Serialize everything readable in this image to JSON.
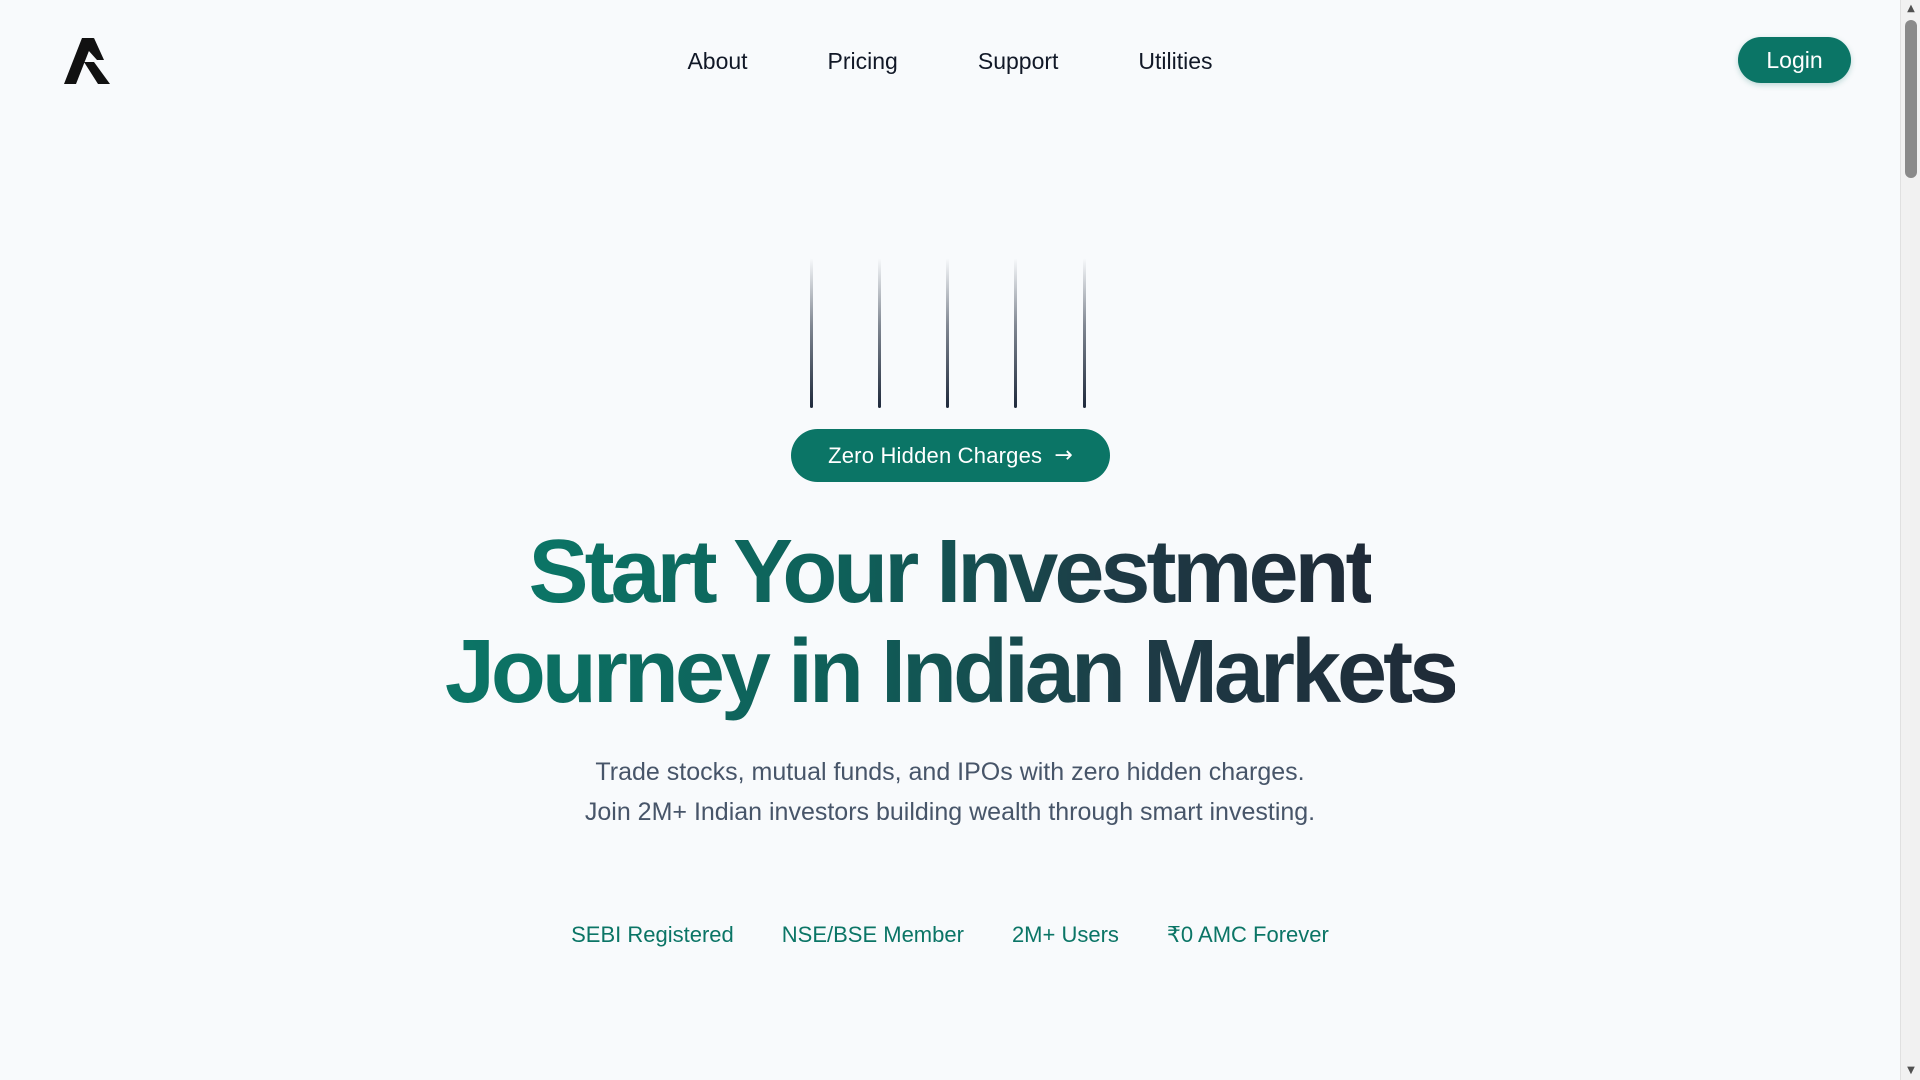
{
  "brand": {
    "logo_icon": "stylized-a-logo-icon"
  },
  "nav": {
    "items": [
      {
        "label": "About"
      },
      {
        "label": "Pricing"
      },
      {
        "label": "Support"
      },
      {
        "label": "Utilities"
      }
    ],
    "login_label": "Login"
  },
  "hero": {
    "pill_label": "Zero Hidden Charges",
    "pill_arrow": "→",
    "title_line1": "Start Your Investment",
    "title_line2": "Journey in Indian Markets",
    "subtitle": "Trade stocks, mutual funds, and IPOs with zero hidden charges. Join 2M+ Indian investors building wealth through smart investing."
  },
  "badges": [
    {
      "label": "SEBI Registered"
    },
    {
      "label": "NSE/BSE Member"
    },
    {
      "label": "2M+ Users"
    },
    {
      "label": "₹0 AMC Forever"
    }
  ],
  "colors": {
    "accent": "#0b7566",
    "background": "#f8fafc",
    "heading_dark": "#1f2a37",
    "text_muted": "#475569"
  },
  "scrollbar": {
    "up_icon": "▲",
    "down_icon": "▼"
  }
}
